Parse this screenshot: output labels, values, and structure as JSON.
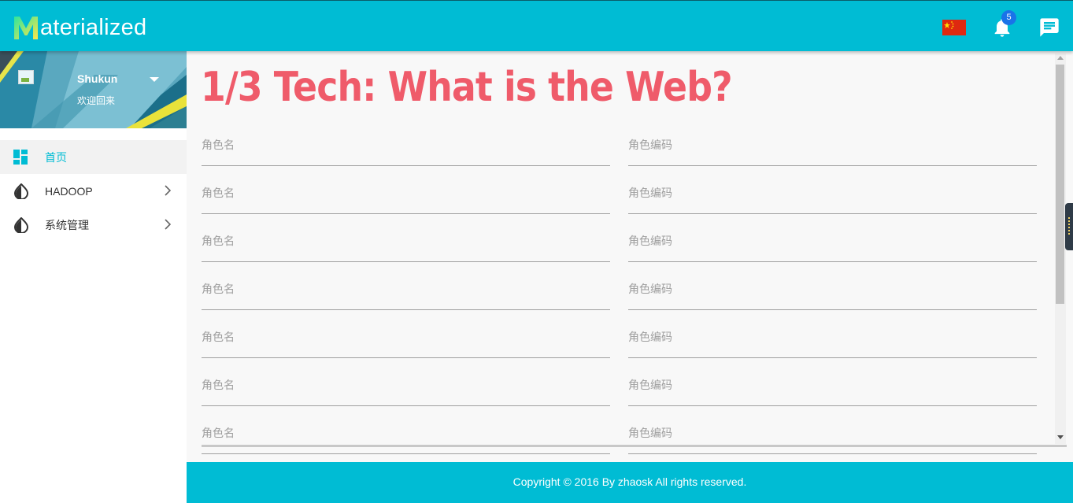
{
  "header": {
    "app_name": "aterialized",
    "logo_letter": "M",
    "notification_count": "5",
    "icons": [
      "china-flag-icon",
      "bell-icon",
      "chat-icon"
    ],
    "accent_color": "#00bcd4"
  },
  "sidebar": {
    "user": {
      "name": "Shukun",
      "welcome": "欢迎回来"
    },
    "items": [
      {
        "label": "首页",
        "icon": "dashboard-icon",
        "active": true
      },
      {
        "label": "HADOOP",
        "icon": "drop-icon",
        "has_submenu": true
      },
      {
        "label": "系统管理",
        "icon": "drop-icon",
        "has_submenu": true
      }
    ]
  },
  "main": {
    "title": "1/3 Tech: What is the Web?",
    "title_color": "#ef5b6a",
    "rows": [
      {
        "left_label": "角色名",
        "right_label": "角色编码"
      },
      {
        "left_label": "角色名",
        "right_label": "角色编码"
      },
      {
        "left_label": "角色名",
        "right_label": "角色编码"
      },
      {
        "left_label": "角色名",
        "right_label": "角色编码"
      },
      {
        "left_label": "角色名",
        "right_label": "角色编码"
      },
      {
        "left_label": "角色名",
        "right_label": "角色编码"
      },
      {
        "left_label": "角色名",
        "right_label": "角色编码"
      }
    ]
  },
  "footer": {
    "text": "Copyright © 2016 By zhaosk All rights reserved."
  }
}
